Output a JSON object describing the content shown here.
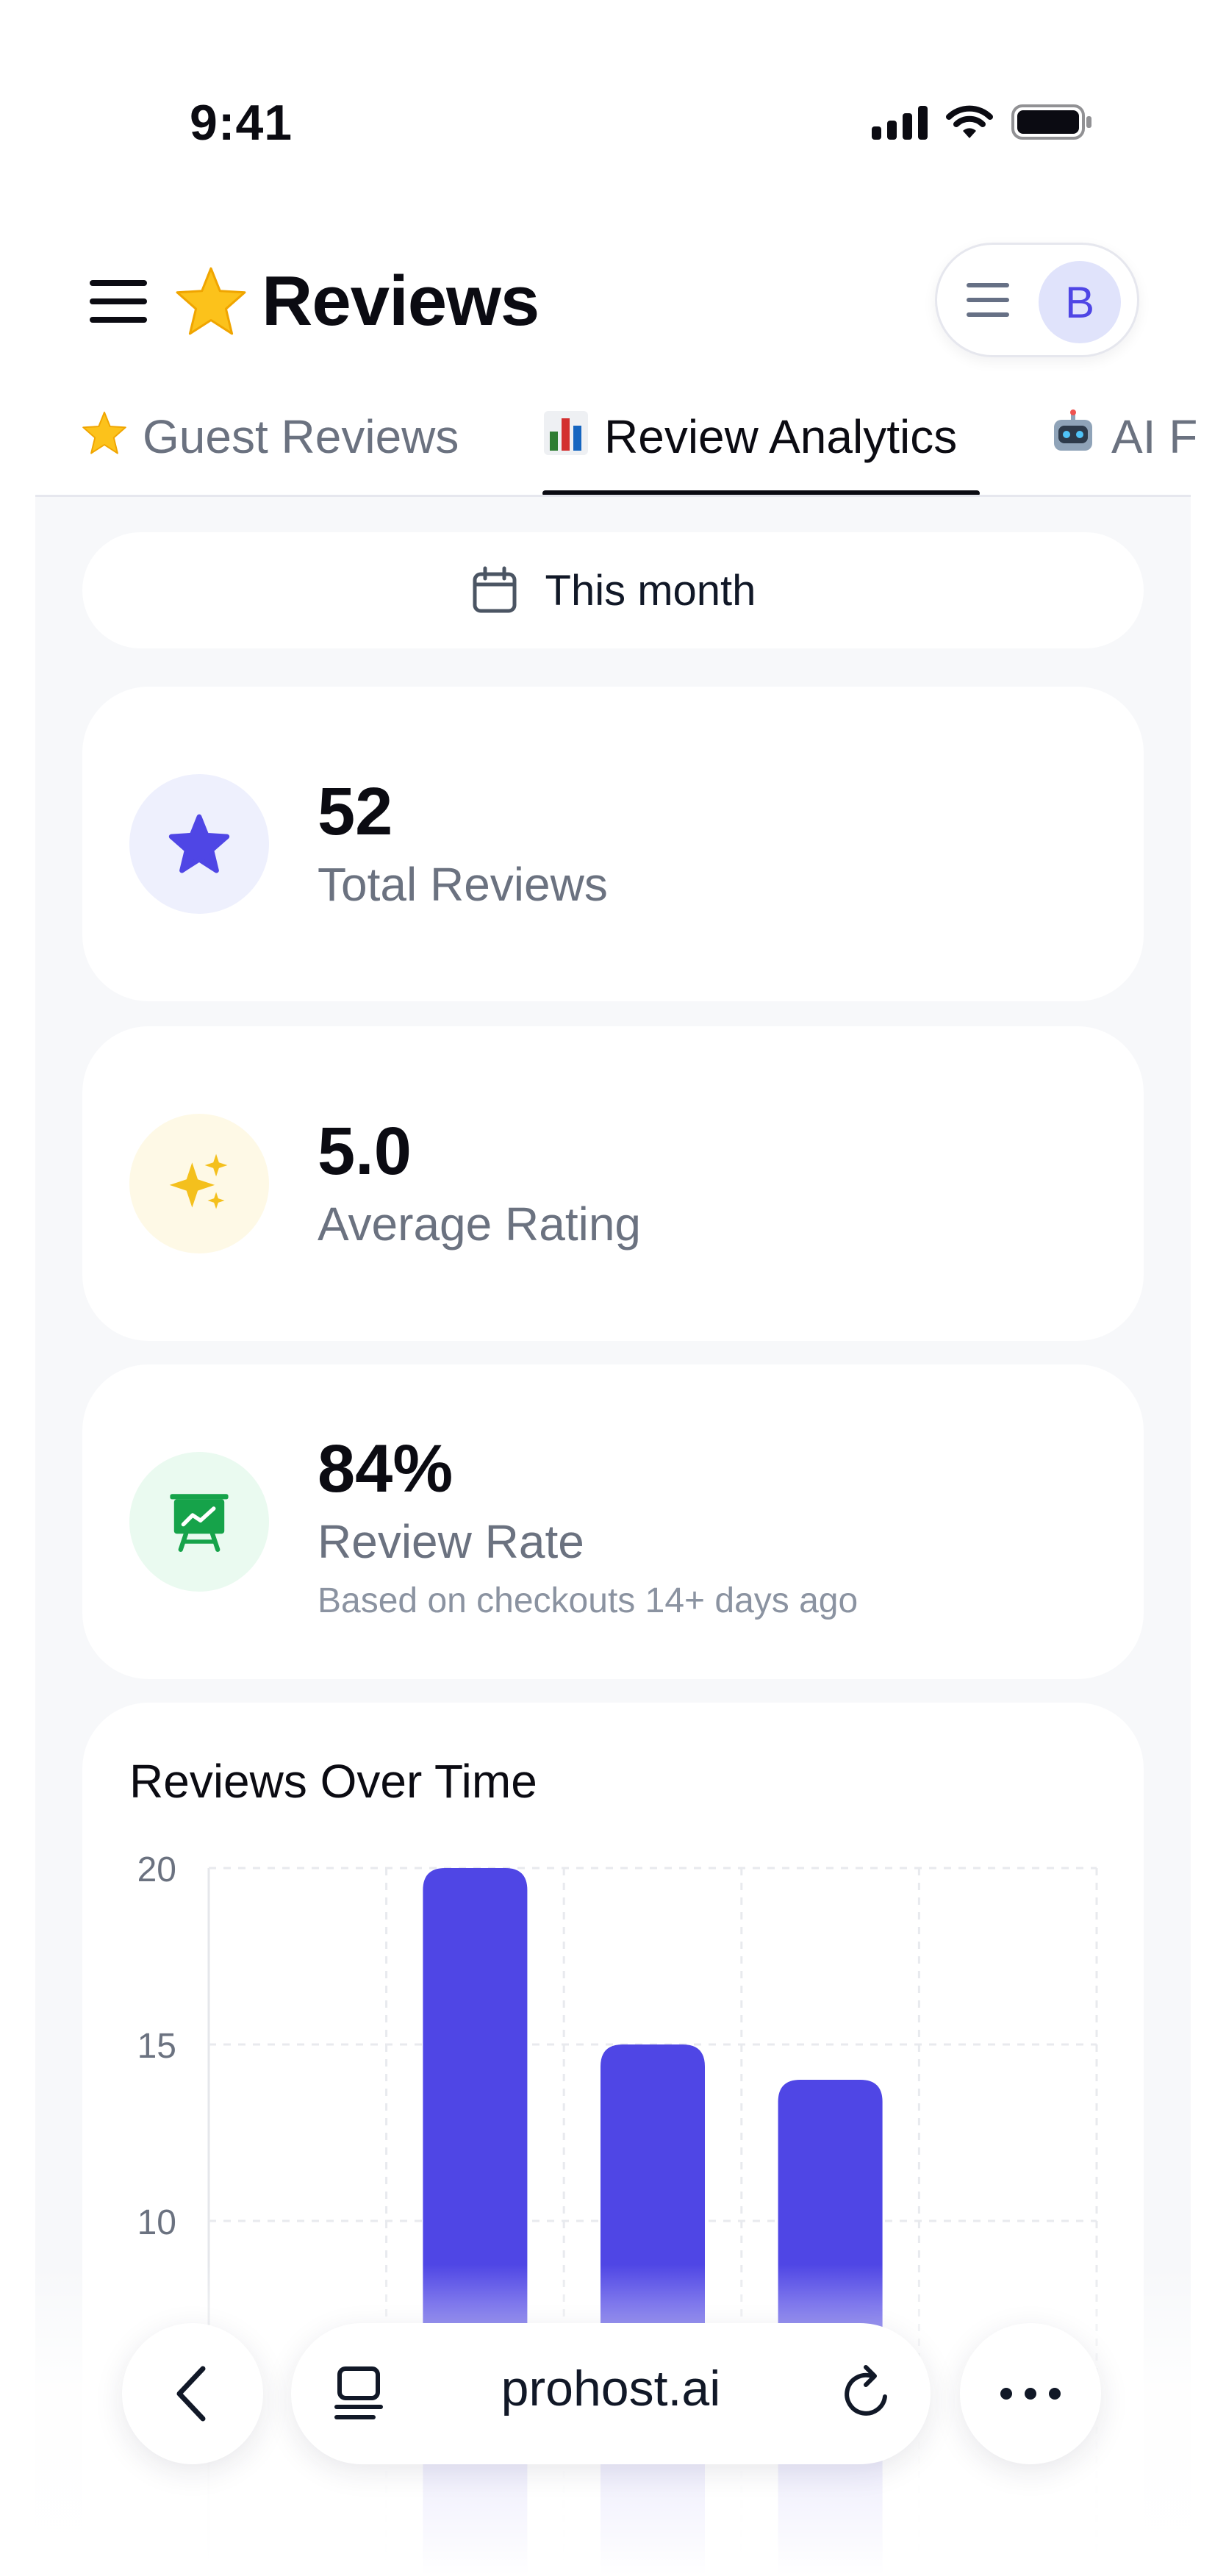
{
  "status_bar": {
    "time": "9:41"
  },
  "header": {
    "title": "Reviews",
    "title_emoji": "star",
    "avatar_letter": "B"
  },
  "tabs": [
    {
      "label": "Guest Reviews",
      "icon": "star-icon",
      "active": false
    },
    {
      "label": "Review Analytics",
      "icon": "bar-chart-icon",
      "active": true
    },
    {
      "label": "AI F",
      "icon": "robot-icon",
      "active": false
    }
  ],
  "filter": {
    "label": "This month"
  },
  "stats": [
    {
      "value": "52",
      "label": "Total Reviews",
      "icon": "star-icon",
      "icon_color": "#4f46e5",
      "icon_bg": "#eef0fd"
    },
    {
      "value": "5.0",
      "label": "Average Rating",
      "icon": "sparkles-icon",
      "icon_color": "#f4c01d",
      "icon_bg": "#fef9e6"
    },
    {
      "value": "84%",
      "label": "Review Rate",
      "sublabel": "Based on checkouts 14+ days ago",
      "icon": "presentation-chart-icon",
      "icon_color": "#16a34a",
      "icon_bg": "#eafaf0"
    }
  ],
  "chart_data": {
    "type": "bar",
    "title": "Reviews Over Time",
    "y_ticks": [
      20,
      15,
      10
    ],
    "values": [
      null,
      20,
      15,
      14,
      null
    ],
    "bar_color": "#4f46e5",
    "grid": true
  },
  "browser": {
    "url": "prohost.ai"
  }
}
